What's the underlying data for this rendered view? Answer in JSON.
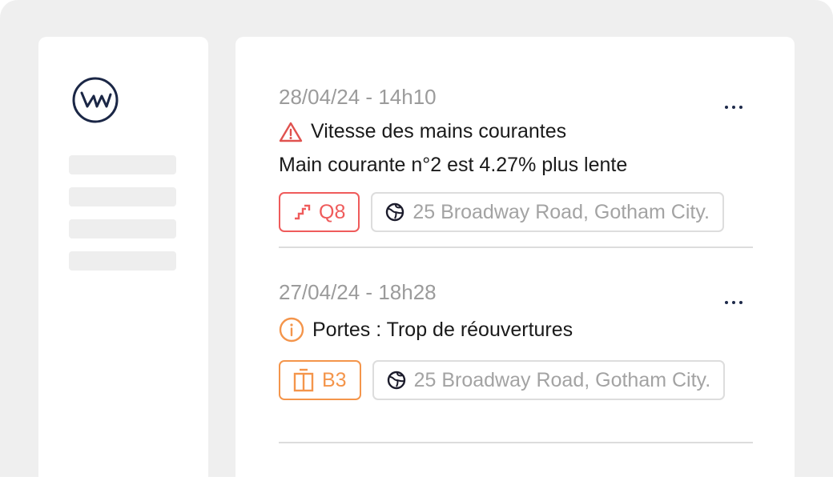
{
  "sidebar": {
    "logo_icon": "wm-logo-icon"
  },
  "alerts": [
    {
      "timestamp": "28/04/24 - 14h10",
      "severity_icon": "warning-triangle-icon",
      "title": "Vitesse des mains courantes",
      "description": "Main courante n°2 est 4.27% plus lente",
      "equipment_icon": "escalator-icon",
      "equipment_code": "Q8",
      "address_icon": "globe-icon",
      "address": "25 Broadway Road, Gotham City.",
      "accent_color": "#ef5b5b"
    },
    {
      "timestamp": "27/04/24 - 18h28",
      "severity_icon": "info-circle-icon",
      "title": "Portes : Trop de réouvertures",
      "equipment_icon": "elevator-icon",
      "equipment_code": "B3",
      "address_icon": "globe-icon",
      "address": "25 Broadway Road, Gotham City.",
      "accent_color": "#f4954b"
    }
  ]
}
